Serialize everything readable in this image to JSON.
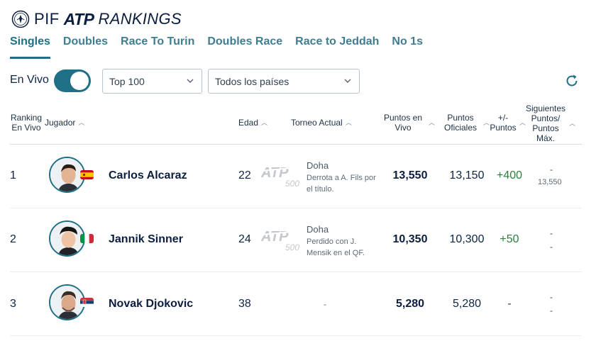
{
  "brand": {
    "pif": "PIF",
    "atp": "ATP",
    "rankings": "RANKINGS"
  },
  "tabs": [
    {
      "label": "Singles",
      "active": true
    },
    {
      "label": "Doubles"
    },
    {
      "label": "Race To Turin"
    },
    {
      "label": "Doubles Race"
    },
    {
      "label": "Race to Jeddah"
    },
    {
      "label": "No 1s"
    }
  ],
  "controls": {
    "live_label": "En Vivo",
    "live_on": true,
    "top_select": "Top 100",
    "country_select": "Todos los países"
  },
  "table": {
    "headers": {
      "rank_l1": "Ranking",
      "rank_l2": "En Vivo",
      "player": "Jugador",
      "age": "Edad",
      "tournament": "Torneo Actual",
      "live_pts_l1": "Puntos en",
      "live_pts_l2": "Vivo",
      "off_pts_l1": "Puntos",
      "off_pts_l2": "Oficiales",
      "diff_l1": "+/-",
      "diff_l2": "Puntos",
      "next_l1": "Siguientes",
      "next_l2": "Puntos/",
      "next_l3": "Puntos",
      "next_l4": "Máx."
    },
    "rows": [
      {
        "rank": "1",
        "name": "Carlos Alcaraz",
        "flag": "ESP",
        "age": "22",
        "tour_logo": "ATP 500",
        "tour_name": "Doha",
        "tour_desc_l1": "Derrota a A. Fils por",
        "tour_desc_l2": "el título.",
        "live_points": "13,550",
        "official_points": "13,150",
        "diff": "+400",
        "next_points": "-",
        "max_points": "13,550"
      },
      {
        "rank": "2",
        "name": "Jannik Sinner",
        "flag": "ITA",
        "age": "24",
        "tour_logo": "ATP 500",
        "tour_name": "Doha",
        "tour_desc_l1": "Perdido con J.",
        "tour_desc_l2": "Mensik en el QF.",
        "live_points": "10,350",
        "official_points": "10,300",
        "diff": "+50",
        "next_points": "-",
        "max_points": "-"
      },
      {
        "rank": "3",
        "name": "Novak Djokovic",
        "flag": "SRB",
        "age": "38",
        "tour_empty": "-",
        "live_points": "5,280",
        "official_points": "5,280",
        "diff": "-",
        "next_points": "-",
        "max_points": "-"
      }
    ]
  },
  "colors": {
    "accent": "#1f6f86",
    "positive": "#2f7d3f",
    "text": "#0b2545"
  }
}
